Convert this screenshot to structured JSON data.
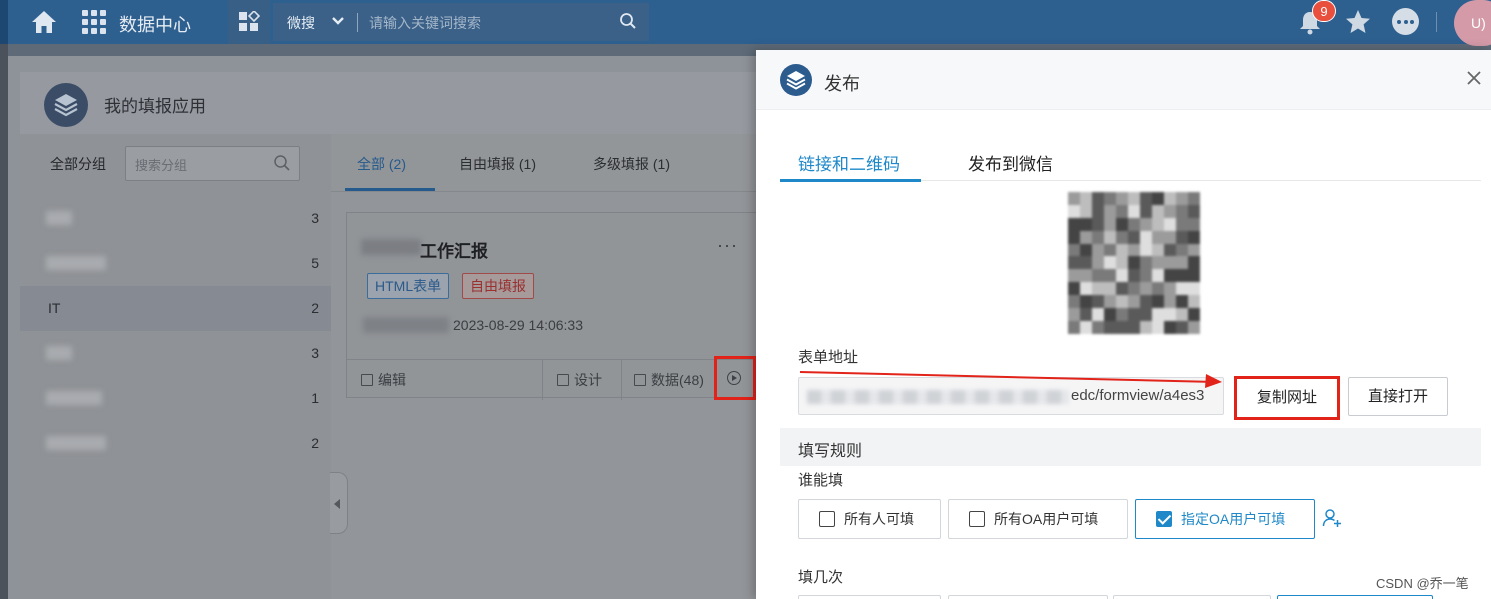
{
  "topbar": {
    "title": "数据中心",
    "search_scope": "微搜",
    "search_placeholder": "请输入关键词搜索",
    "notification_count": "9",
    "avatar_text": "U)"
  },
  "app": {
    "title": "我的填报应用"
  },
  "groups": {
    "label": "全部分组",
    "search_placeholder": "搜索分组",
    "items": [
      {
        "name": "",
        "count": "3"
      },
      {
        "name": "",
        "count": "5"
      },
      {
        "name": "IT",
        "count": "2"
      },
      {
        "name": "",
        "count": "3"
      },
      {
        "name": "",
        "count": "1"
      },
      {
        "name": "",
        "count": "2"
      }
    ]
  },
  "tabs": [
    {
      "label": "全部 (2)"
    },
    {
      "label": "自由填报 (1)"
    },
    {
      "label": "多级填报 (1)"
    }
  ],
  "form_card": {
    "title": "工作汇报",
    "tags": [
      "HTML表单",
      "自由填报"
    ],
    "time": "2023-08-29 14:06:33",
    "actions": {
      "edit": "编辑",
      "design": "设计",
      "data": "数据(48)"
    }
  },
  "drawer": {
    "title": "发布",
    "tabs": [
      "链接和二维码",
      "发布到微信"
    ],
    "address_label": "表单地址",
    "url_visible": "edc/formview/a4es3",
    "copy_button": "复制网址",
    "open_button": "直接打开",
    "rules_title": "填写规则",
    "who_label": "谁能填",
    "who_options": [
      {
        "label": "所有人可填",
        "checked": false
      },
      {
        "label": "所有OA用户可填",
        "checked": false
      },
      {
        "label": "指定OA用户可填",
        "checked": true
      }
    ],
    "times_label": "填几次"
  },
  "watermark": "CSDN @乔一笔",
  "colors": {
    "topbar": "#2d5f8f",
    "accent": "#1f88c9",
    "highlight": "#e2231a"
  }
}
